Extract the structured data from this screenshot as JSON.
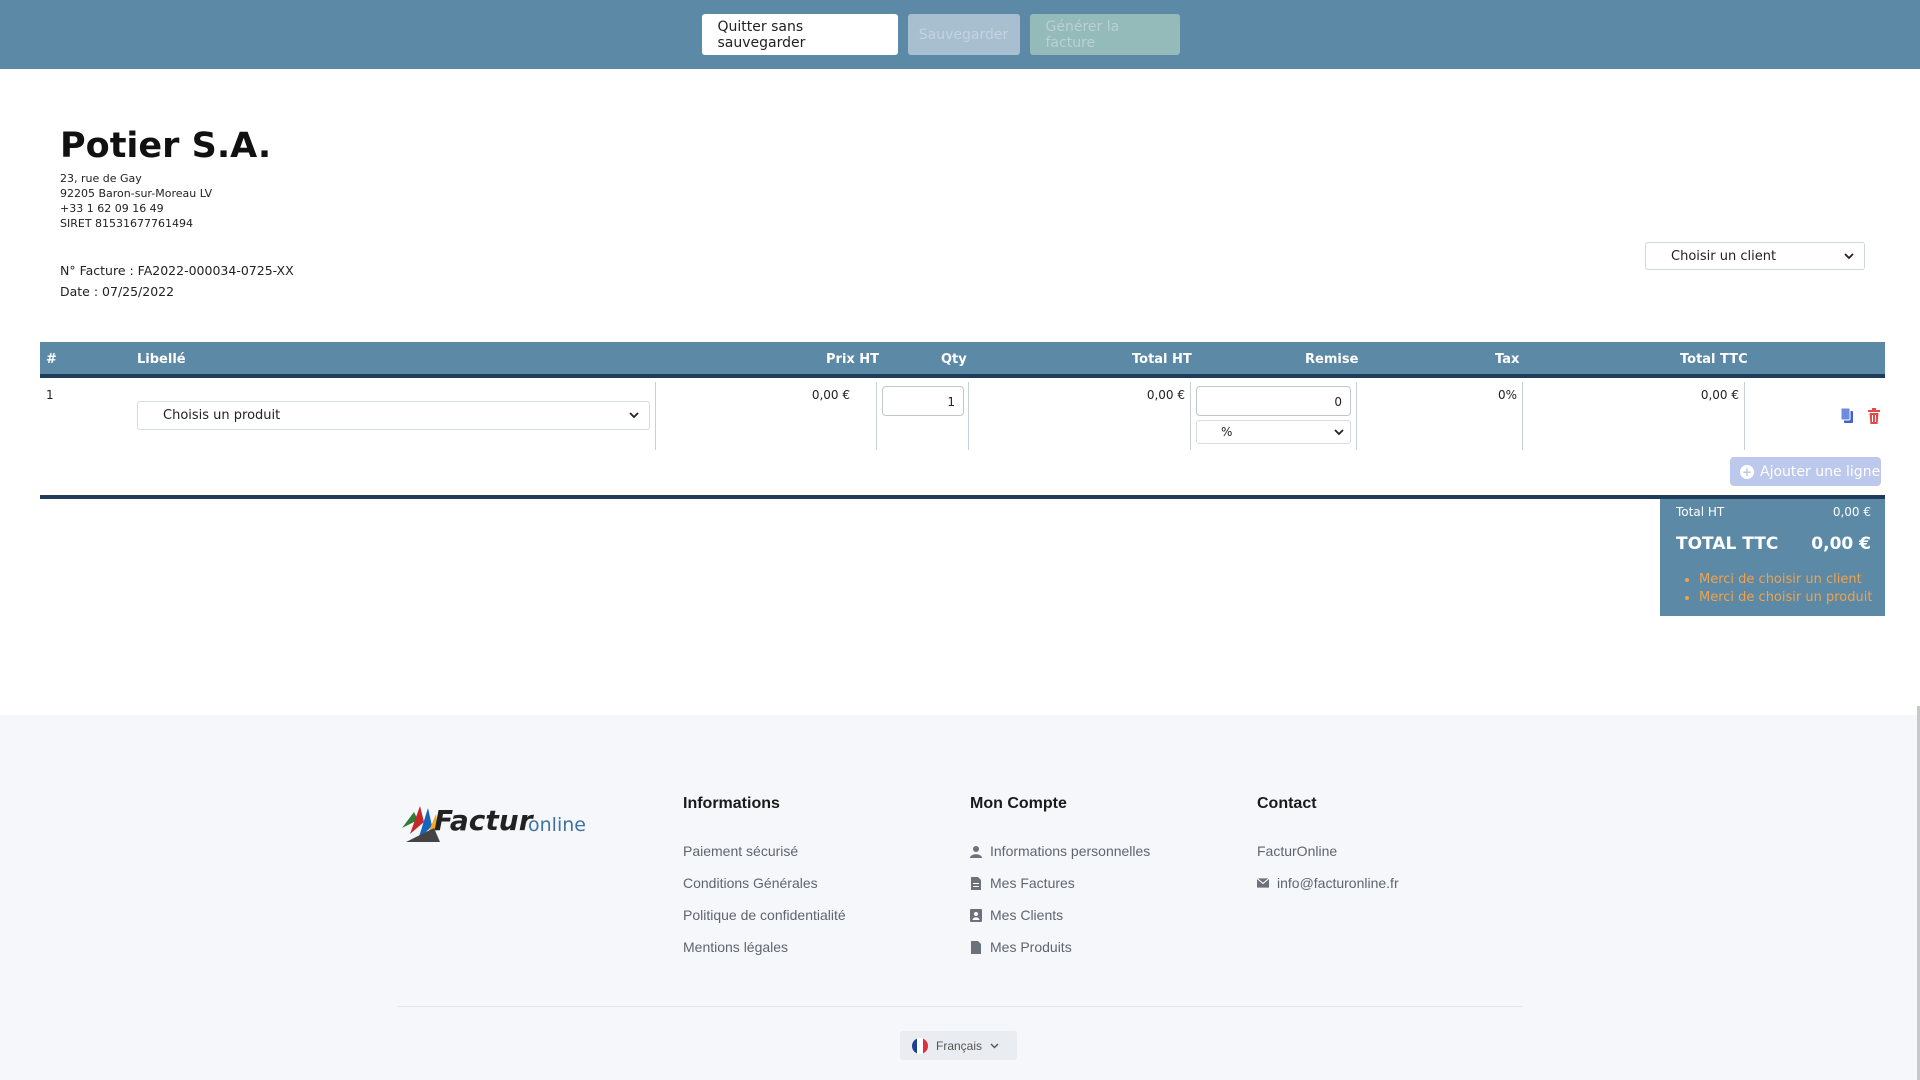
{
  "topbar": {
    "quit_label": "Quitter sans sauvegarder",
    "save_label": "Sauvegarder",
    "generate_label": "Générer la facture"
  },
  "company": {
    "name": "Potier S.A.",
    "address1": "23, rue de Gay",
    "address2": "92205 Baron-sur-Moreau LV",
    "phone": "+33 1 62 09 16 49",
    "siret": "SIRET 81531677761494"
  },
  "invoice": {
    "number": "N° Facture : FA2022-000034-0725-XX",
    "date": "Date : 07/25/2022"
  },
  "client_select": {
    "value": "Choisir un client"
  },
  "table": {
    "headers": {
      "num": "#",
      "label": "Libellé",
      "price": "Prix HT",
      "qty": "Qty",
      "total_ht": "Total HT",
      "discount": "Remise",
      "tax": "Tax",
      "total_ttc": "Total TTC"
    },
    "rows": [
      {
        "num": "1",
        "product": "Choisis un produit",
        "price": "0,00 €",
        "qty": "1",
        "total_ht": "0,00 €",
        "discount": "0",
        "discount_type": "%",
        "tax": "0%",
        "total_ttc": "0,00 €"
      }
    ],
    "add_line_label": "Ajouter une ligne"
  },
  "totals": {
    "total_ht_label": "Total HT",
    "total_ht_value": "0,00 €",
    "total_ttc_label": "TOTAL TTC",
    "total_ttc_value": "0,00 €",
    "warnings": [
      "Merci de choisir un client",
      "Merci de choisir un produit"
    ]
  },
  "footer": {
    "logo_text_a": "Factur",
    "logo_text_b": "online",
    "informations": {
      "title": "Informations",
      "items": [
        "Paiement sécurisé",
        "Conditions Générales",
        "Politique de confidentialité",
        "Mentions légales"
      ]
    },
    "account": {
      "title": "Mon Compte",
      "items": [
        "Informations personnelles",
        "Mes Factures",
        "Mes Clients",
        "Mes Produits"
      ]
    },
    "contact": {
      "title": "Contact",
      "company": "FacturOnline",
      "email": "info@facturonline.fr"
    },
    "language": "Français"
  },
  "colors": {
    "header_blue": "#5b89a6",
    "dark_navy": "#1f3d5a",
    "warning_orange": "#f0a24e",
    "footer_bg": "#f5f7fa"
  }
}
